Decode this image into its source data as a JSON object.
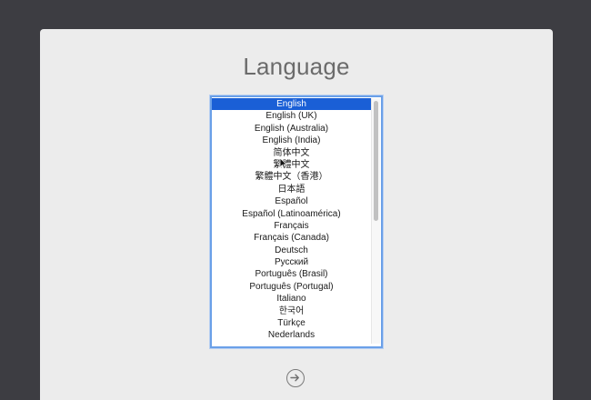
{
  "window": {
    "title": "Language"
  },
  "language_list": {
    "selected_index": 0,
    "items": [
      {
        "label": "English"
      },
      {
        "label": "English (UK)"
      },
      {
        "label": "English (Australia)"
      },
      {
        "label": "English (India)"
      },
      {
        "label": "简体中文"
      },
      {
        "label": "繁體中文"
      },
      {
        "label": "繁體中文（香港）"
      },
      {
        "label": "日本語"
      },
      {
        "label": "Español"
      },
      {
        "label": "Español (Latinoamérica)"
      },
      {
        "label": "Français"
      },
      {
        "label": "Français (Canada)"
      },
      {
        "label": "Deutsch"
      },
      {
        "label": "Русский"
      },
      {
        "label": "Português (Brasil)"
      },
      {
        "label": "Português (Portugal)"
      },
      {
        "label": "Italiano"
      },
      {
        "label": "한국어"
      },
      {
        "label": "Türkçe"
      },
      {
        "label": "Nederlands"
      }
    ]
  },
  "continue_button": {
    "icon": "arrow-right-circle-icon"
  },
  "colors": {
    "background": "#3d3d42",
    "panel": "#ececec",
    "title": "#6b6b6b",
    "selection": "#1a5fd6",
    "focus_ring": "#6aa0e8"
  }
}
